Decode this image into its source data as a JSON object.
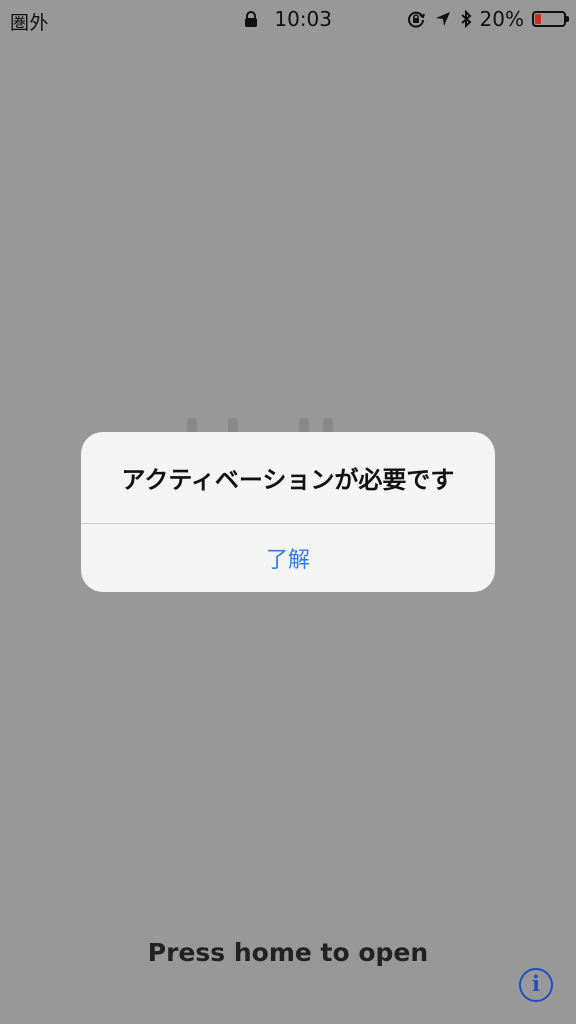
{
  "status_bar": {
    "carrier": "圏外",
    "time": "10:03",
    "battery_percent": "20%",
    "battery_level": 0.2,
    "icons": [
      "lock-icon",
      "rotation-lock-icon",
      "location-icon",
      "bluetooth-icon",
      "battery-icon"
    ],
    "battery_color": "#d02a1d"
  },
  "alert": {
    "title": "アクティベーションが必要です",
    "button_label": "了解",
    "button_color": "#2f7cf6"
  },
  "lock_screen": {
    "hint": "Press home to open",
    "info_icon": "info-icon"
  },
  "colors": {
    "background": "#989898",
    "alert_background": "#f4f4f4",
    "info_icon": "#1f4fc0"
  }
}
